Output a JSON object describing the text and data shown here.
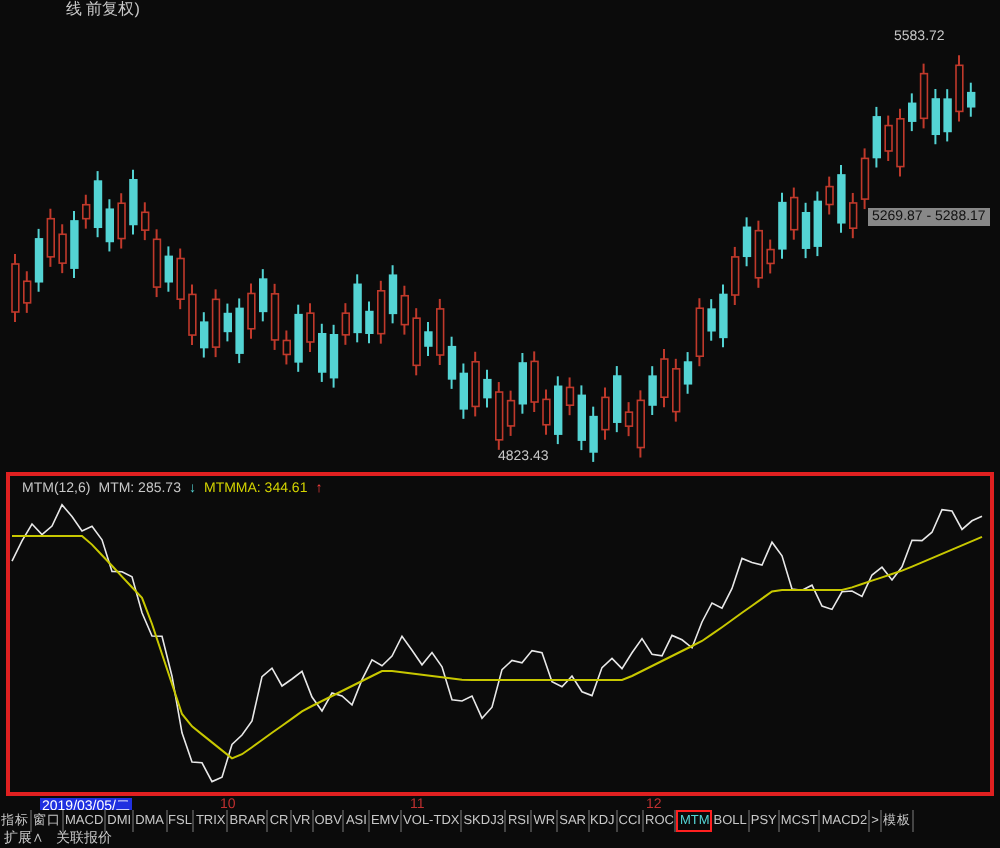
{
  "title": "线 前复权)",
  "price_chart": {
    "high_label": "5583.72",
    "range_label": "5269.87 - 5288.17",
    "low_label": "4823.43"
  },
  "indicator": {
    "name": "MTM(12,6)",
    "mtm": "MTM: 285.73",
    "mtm_mark": "↓",
    "mtmma": "MTMMA: 344.61",
    "mtmma_mark": "↑"
  },
  "x_axis": {
    "cursor_date": "2019/03/05/二",
    "labels": [
      "10",
      "11",
      "12"
    ]
  },
  "tabs": [
    {
      "label": "指标",
      "selected": false
    },
    {
      "label": "窗口",
      "selected": false
    },
    {
      "label": "MACD",
      "selected": false
    },
    {
      "label": "DMI",
      "selected": false
    },
    {
      "label": "DMA",
      "selected": false
    },
    {
      "label": "FSL",
      "selected": false
    },
    {
      "label": "TRIX",
      "selected": false
    },
    {
      "label": "BRAR",
      "selected": false
    },
    {
      "label": "CR",
      "selected": false
    },
    {
      "label": "VR",
      "selected": false
    },
    {
      "label": "OBV",
      "selected": false
    },
    {
      "label": "ASI",
      "selected": false
    },
    {
      "label": "EMV",
      "selected": false
    },
    {
      "label": "VOL-TDX",
      "selected": false
    },
    {
      "label": "SKDJ3",
      "selected": false
    },
    {
      "label": "RSI",
      "selected": false
    },
    {
      "label": "WR",
      "selected": false
    },
    {
      "label": "SAR",
      "selected": false
    },
    {
      "label": "KDJ",
      "selected": false
    },
    {
      "label": "CCI",
      "selected": false
    },
    {
      "label": "ROC",
      "selected": false
    },
    {
      "label": "MTM",
      "selected": true
    },
    {
      "label": "BOLL",
      "selected": false
    },
    {
      "label": "PSY",
      "selected": false
    },
    {
      "label": "MCST",
      "selected": false
    },
    {
      "label": "MACD2",
      "selected": false
    },
    {
      "label": ">",
      "selected": false
    },
    {
      "label": "模板",
      "selected": false
    }
  ],
  "bottom_links": [
    "扩展∧",
    "关联报价"
  ]
}
